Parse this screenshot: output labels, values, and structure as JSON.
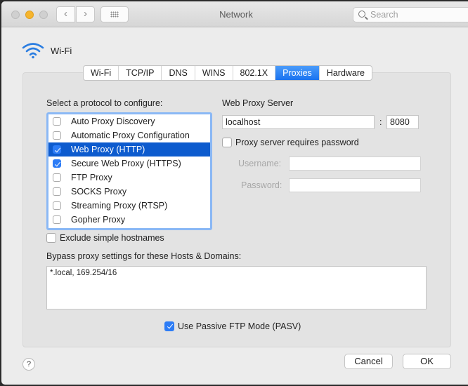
{
  "window": {
    "title": "Network",
    "search_placeholder": "Search"
  },
  "interface": {
    "name": "Wi-Fi",
    "icon": "wifi-icon"
  },
  "tabs": [
    {
      "label": "Wi-Fi",
      "active": false
    },
    {
      "label": "TCP/IP",
      "active": false
    },
    {
      "label": "DNS",
      "active": false
    },
    {
      "label": "WINS",
      "active": false
    },
    {
      "label": "802.1X",
      "active": false
    },
    {
      "label": "Proxies",
      "active": true
    },
    {
      "label": "Hardware",
      "active": false
    }
  ],
  "protocols": {
    "heading": "Select a protocol to configure:",
    "items": [
      {
        "label": "Auto Proxy Discovery",
        "checked": false,
        "selected": false
      },
      {
        "label": "Automatic Proxy Configuration",
        "checked": false,
        "selected": false
      },
      {
        "label": "Web Proxy (HTTP)",
        "checked": true,
        "selected": true
      },
      {
        "label": "Secure Web Proxy (HTTPS)",
        "checked": true,
        "selected": false
      },
      {
        "label": "FTP Proxy",
        "checked": false,
        "selected": false
      },
      {
        "label": "SOCKS Proxy",
        "checked": false,
        "selected": false
      },
      {
        "label": "Streaming Proxy (RTSP)",
        "checked": false,
        "selected": false
      },
      {
        "label": "Gopher Proxy",
        "checked": false,
        "selected": false
      }
    ]
  },
  "exclude_simple": {
    "label": "Exclude simple hostnames",
    "checked": false
  },
  "server": {
    "heading": "Web Proxy Server",
    "host": "localhost",
    "separator": ":",
    "port": "8080",
    "requires_password": {
      "label": "Proxy server requires password",
      "checked": false
    },
    "username_label": "Username:",
    "username": "",
    "password_label": "Password:",
    "password": ""
  },
  "bypass": {
    "label": "Bypass proxy settings for these Hosts & Domains:",
    "value": "*.local, 169.254/16"
  },
  "pasv": {
    "label": "Use Passive FTP Mode (PASV)",
    "checked": true
  },
  "buttons": {
    "help": "?",
    "cancel": "Cancel",
    "ok": "OK"
  },
  "colors": {
    "accent": "#1a73f0",
    "selection": "#0d5bce",
    "traffic_minimize": "#f6b52e"
  }
}
